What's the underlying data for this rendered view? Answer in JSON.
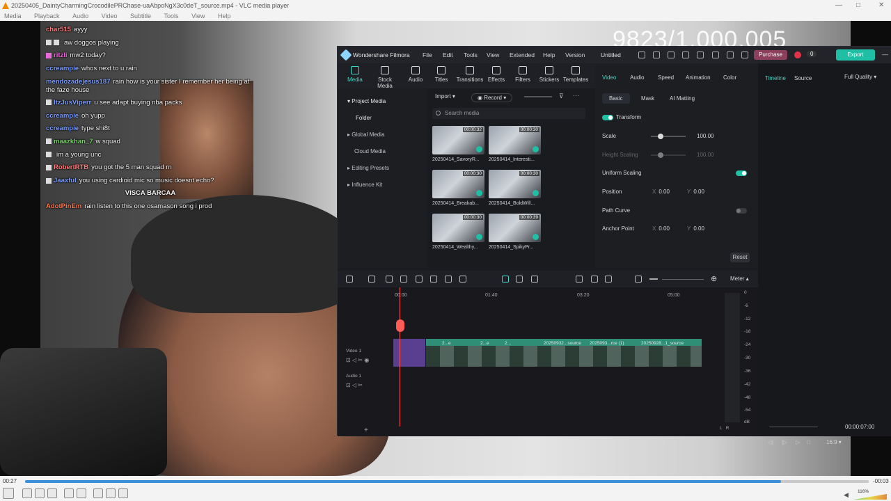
{
  "window": {
    "title": "20250405_DaintyCharmingCrocodilePRChase-uaAbpoNgX3c0deT_source.mp4 - VLC media player",
    "menu": [
      "Media",
      "Playback",
      "Audio",
      "Video",
      "Subtitle",
      "Tools",
      "View",
      "Help"
    ]
  },
  "stream": {
    "score": "9823/1,000,005",
    "chat": [
      {
        "user": "char515",
        "msg": "ayyy",
        "color": "#ff7a7a"
      },
      {
        "user": "",
        "msg": "aw doggos playing",
        "color": "#c9a06a"
      },
      {
        "user": "ritzli",
        "msg": "mw2 today?",
        "color": "#e86ad8"
      },
      {
        "user": "ccreampie",
        "msg": "whos next to u rain",
        "color": "#7a9cff"
      },
      {
        "user": "mendozadejesus187",
        "msg": "rain how is your sister I remember her being at the faze house",
        "color": "#7a9cff"
      },
      {
        "user": "ItzJusViperr",
        "msg": "u see adapt buying nba packs",
        "color": "#7a9cff"
      },
      {
        "user": "ccreampie",
        "msg": "oh yupp",
        "color": "#7a9cff"
      },
      {
        "user": "ccreampie",
        "msg": "type shi8t",
        "color": "#7a9cff"
      },
      {
        "user": "maazkhan_7",
        "msg": "w squad",
        "color": "#7ad36a"
      },
      {
        "user": "",
        "msg": "im a young unc",
        "color": "#ff5a5a"
      },
      {
        "user": "RobertRTB",
        "msg": "you got the 5 man squad rn",
        "color": "#ff7a7a"
      },
      {
        "user": "Jaaxful",
        "msg": "you using cardioid mic so music doesnt echo?",
        "color": "#7a9cff"
      },
      {
        "user": "",
        "msg": "VISCA BARCAA",
        "color": "#ffffff"
      },
      {
        "user": "AdotPinEm",
        "msg": "rain listen to this one osamason song i prod",
        "color": "#ff7a4a"
      }
    ]
  },
  "filmora": {
    "app_name": "Wondershare Filmora",
    "menu": [
      "File",
      "Edit",
      "Tools",
      "View",
      "Extended",
      "Help",
      "Version"
    ],
    "project": "Untitled",
    "purchase": "Purchase",
    "counter": "0",
    "export": "Export",
    "toolbar": [
      "Media",
      "Stock Media",
      "Audio",
      "Titles",
      "Transitions",
      "Effects",
      "Filters",
      "Stickers",
      "Templates"
    ],
    "library": [
      "Project Media",
      "Folder",
      "Global Media",
      "Cloud Media",
      "Editing Presets",
      "Influence Kit"
    ],
    "import": "Import",
    "record": "Record",
    "search_placeholder": "Search media",
    "media": [
      {
        "name": "20250414_SavoryR...",
        "dur": "00:00:32"
      },
      {
        "name": "20250414_Interesti...",
        "dur": "00:00:30"
      },
      {
        "name": "20250414_Breakab...",
        "dur": "00:00:30"
      },
      {
        "name": "20250414_BoldWill...",
        "dur": "00:00:30"
      },
      {
        "name": "20250414_Wealthy...",
        "dur": "00:00:30"
      },
      {
        "name": "20250414_SpikyPr...",
        "dur": "00:00:39"
      }
    ],
    "prop_tabs": [
      "Video",
      "Audio",
      "Speed",
      "Animation",
      "Color"
    ],
    "sub_tabs": [
      "Basic",
      "Mask",
      "AI Matting"
    ],
    "transform": "Transform",
    "scale_label": "Scale",
    "scale_value": "100.00",
    "height_scaling": "Height Scaling",
    "height_value": "100.00",
    "uniform_scaling": "Uniform Scaling",
    "position": "Position",
    "pos_x": "0.00",
    "pos_y": "0.00",
    "path_curve": "Path Curve",
    "anchor": "Anchor Point",
    "anc_x": "0.00",
    "anc_y": "0.00",
    "x_key": "X",
    "y_key": "Y",
    "reset": "Reset",
    "preview_tabs": [
      "Timeline",
      "Source"
    ],
    "quality": "Full Quality",
    "preview_time": "00:00:07:00",
    "ratio": "16:9",
    "meter": "Meter",
    "ruler": [
      "00:00",
      "01:40",
      "03:20",
      "05:00"
    ],
    "track_video": "Video 1",
    "track_audio": "Audio 1",
    "clips": [
      "2...e",
      "2...e",
      "2...",
      "20250932...source",
      "2025093...rce (1)",
      "20250928...1_source"
    ],
    "meter_scale": [
      "0",
      "-6",
      "-12",
      "-18",
      "-24",
      "-30",
      "-36",
      "-42",
      "-48",
      "-54",
      "dB"
    ],
    "meter_lr": "L   R"
  },
  "player": {
    "elapsed": "00:27",
    "remaining": "-00:03",
    "progress": 0.896,
    "volume": "116%"
  }
}
